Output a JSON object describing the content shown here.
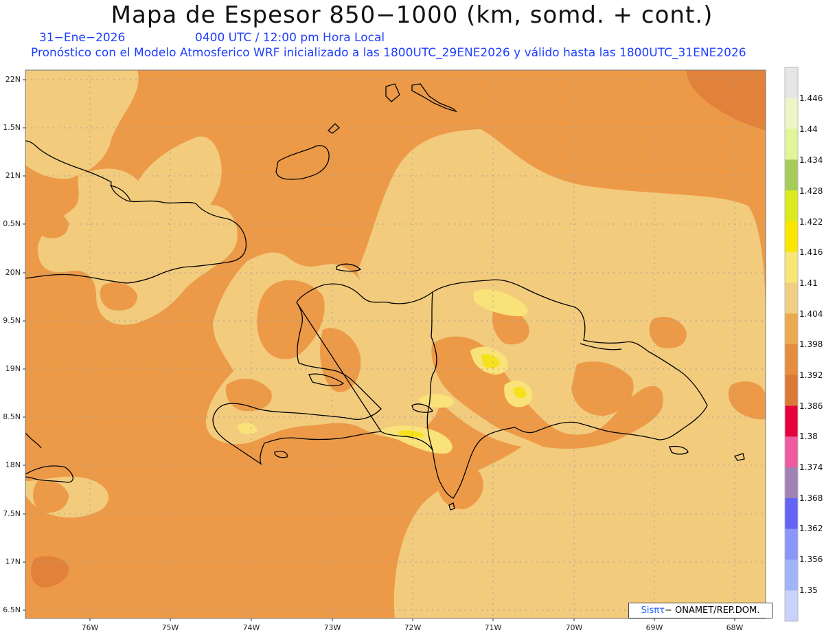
{
  "title": "Mapa de Espesor 850−1000 (km, somd. + cont.)",
  "date_label": "31−Ene−2026",
  "time_label": "0400 UTC / 12:00 pm Hora Local",
  "forecast_label": "Pronóstico con el Modelo Atmosferico WRF inicializado a las 1800UTC_29ENE2026 y válido hasta las  1800UTC_31ENE2026",
  "lat_ticks": [
    "22N",
    "1.5N",
    "21N",
    "0.5N",
    "20N",
    "9.5N",
    "19N",
    "8.5N",
    "18N",
    "7.5N",
    "17N",
    "6.5N"
  ],
  "lon_ticks": [
    "76W",
    "75W",
    "74W",
    "73W",
    "72W",
    "71W",
    "70W",
    "69W",
    "68W"
  ],
  "legend": {
    "levels": [
      "1.446",
      "1.44",
      "1.434",
      "1.428",
      "1.422",
      "1.416",
      "1.41",
      "1.404",
      "1.398",
      "1.392",
      "1.386",
      "1.38",
      "1.374",
      "1.368",
      "1.362",
      "1.356",
      "1.35"
    ],
    "colors": [
      "#e6e6e6",
      "#f0f5c8",
      "#e2f598",
      "#a5cc5a",
      "#dbea1e",
      "#fae600",
      "#fae678",
      "#f1cf82",
      "#ecaa4e",
      "#e58c3e",
      "#dc7837",
      "#e6003c",
      "#f05aa0",
      "#a082b4",
      "#6464f5",
      "#8c96fa",
      "#a0b4fa",
      "#c8d2fa"
    ]
  },
  "credit": {
    "logo_text": "Sisπτ",
    "text": "− ONAMET/REP.DOM."
  },
  "colors": {
    "warm": "#ec9a48",
    "light": "#f2cb7d",
    "pale_yellow": "#f9e27a",
    "yellow": "#f6e21a",
    "dark_orange": "#e2823a",
    "coast": "#000000",
    "grid": "#a0a0a0"
  }
}
